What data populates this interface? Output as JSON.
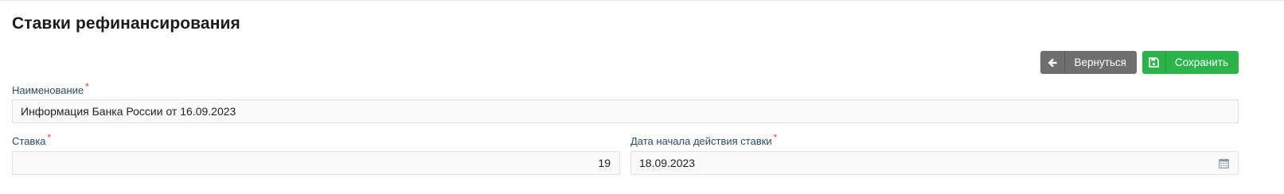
{
  "page": {
    "title": "Ставки рефинансирования"
  },
  "toolbar": {
    "back": {
      "icon": "arrow-left-icon",
      "label": "Вернуться"
    },
    "save": {
      "icon": "floppy-disk-icon",
      "label": "Сохранить"
    }
  },
  "form": {
    "name": {
      "label": "Наименование",
      "required_mark": "*",
      "value": "Информация Банка России от 16.09.2023"
    },
    "rate": {
      "label": "Ставка",
      "required_mark": "*",
      "value": "19"
    },
    "start_date": {
      "label": "Дата начала действия ставки",
      "required_mark": "*",
      "value": "18.09.2023",
      "icon": "calendar-icon"
    }
  },
  "colors": {
    "back_button": "#6f6f6f",
    "save_button": "#2cb34a",
    "label": "#2b4a68",
    "required": "#e53935",
    "input_bg": "#f7f9fb",
    "input_border": "#dde2e7"
  }
}
